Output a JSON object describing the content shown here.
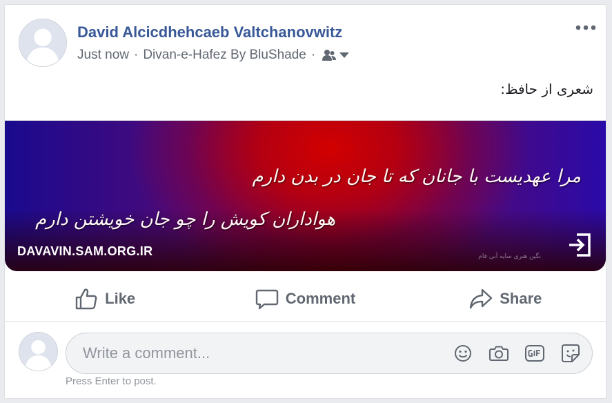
{
  "post": {
    "author": "David Alcicdhehcaeb Valtchanovwitz",
    "time": "Just now",
    "separator": "·",
    "group": "Divan-e-Hafez By BluShade",
    "audience_icon": "friends-icon",
    "menu_icon": "more-options-icon",
    "text": "شعری از حافظ:"
  },
  "link_preview": {
    "poem_line_1": "مرا عهدیست با جانان که تا جان در بدن دارم",
    "poem_line_2": "هواداران کویش را چو جان خویشتن دارم",
    "domain": "DAVAVIN.SAM.ORG.IR",
    "watermark": "نگین هنری سایه آبی فام",
    "open_icon": "open-link-icon",
    "colors": {
      "blue": "#1a0a8e",
      "red": "#d20000"
    }
  },
  "actions": [
    {
      "label": "Like",
      "icon": "thumbs-up-icon"
    },
    {
      "label": "Comment",
      "icon": "comment-bubble-icon"
    },
    {
      "label": "Share",
      "icon": "share-arrow-icon"
    }
  ],
  "comment": {
    "placeholder": "Write a comment...",
    "hint": "Press Enter to post.",
    "icons": [
      "emoji-icon",
      "camera-icon",
      "gif-icon",
      "sticker-icon"
    ]
  },
  "colors": {
    "link": "#385898",
    "muted": "#616770",
    "action": "#606770"
  }
}
